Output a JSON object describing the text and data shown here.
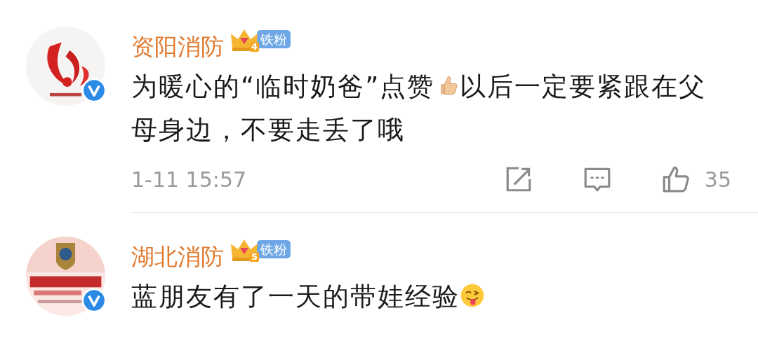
{
  "comments": [
    {
      "avatar": {
        "kind": "picture",
        "verified": true
      },
      "name": "资阳消防",
      "fan_level": "4",
      "fan_badge": "铁粉",
      "content": [
        {
          "kind": "text",
          "text": "为暖心的“临时奶爸”点赞"
        },
        {
          "kind": "thumbsup"
        },
        {
          "kind": "text",
          "text": "以后一定要紧跟在父母身边，不要走丢了哦"
        }
      ],
      "time": "1-11 15:57",
      "likes": "35"
    },
    {
      "avatar": {
        "kind": "picture",
        "verified": true
      },
      "name": "湖北消防",
      "fan_level": "5",
      "fan_badge": "铁粉",
      "content": [
        {
          "kind": "text",
          "text": "蓝朋友有了一天的带娃经验"
        },
        {
          "kind": "tongue"
        }
      ]
    }
  ]
}
